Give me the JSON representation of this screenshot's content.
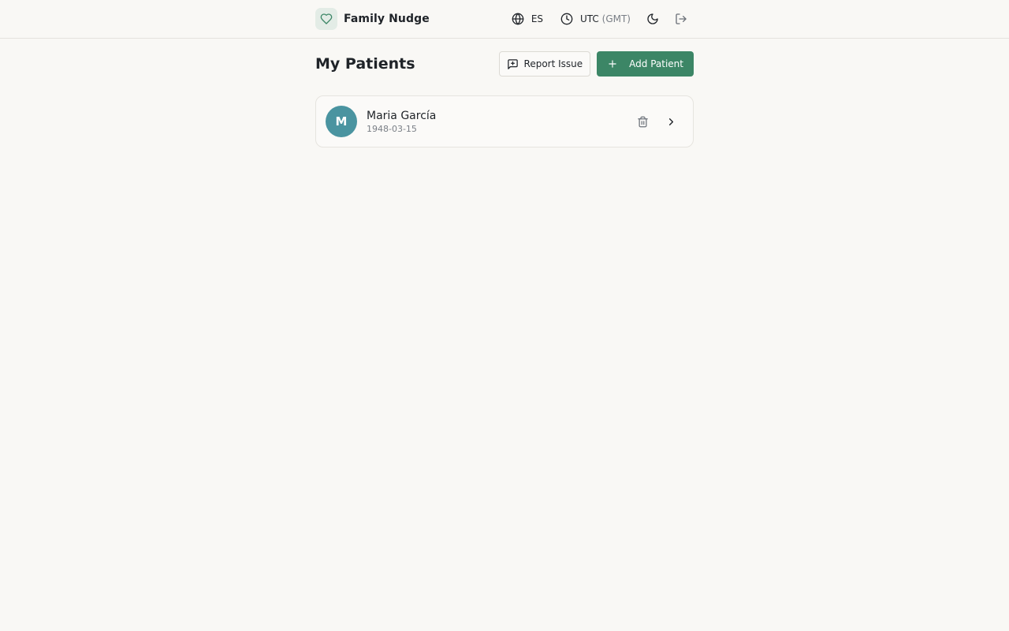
{
  "header": {
    "app_name": "Family Nudge",
    "language": "ES",
    "timezone": "UTC",
    "timezone_detail": "(GMT)",
    "icons": {
      "logo": "heart-icon",
      "language": "globe-icon",
      "timezone": "clock-icon",
      "theme": "moon-icon",
      "logout": "logout-icon"
    }
  },
  "page": {
    "title": "My Patients",
    "report_issue_label": "Report Issue",
    "add_patient_label": "Add Patient"
  },
  "patients": [
    {
      "initial": "M",
      "name": "Maria García",
      "dob": "1948-03-15"
    }
  ],
  "colors": {
    "background": "#f9f8f5",
    "primary": "#3c8666",
    "avatar": "#4a94a0",
    "logo_bg": "#e3ece6",
    "text": "#1f2328",
    "muted": "#7a7f86"
  }
}
